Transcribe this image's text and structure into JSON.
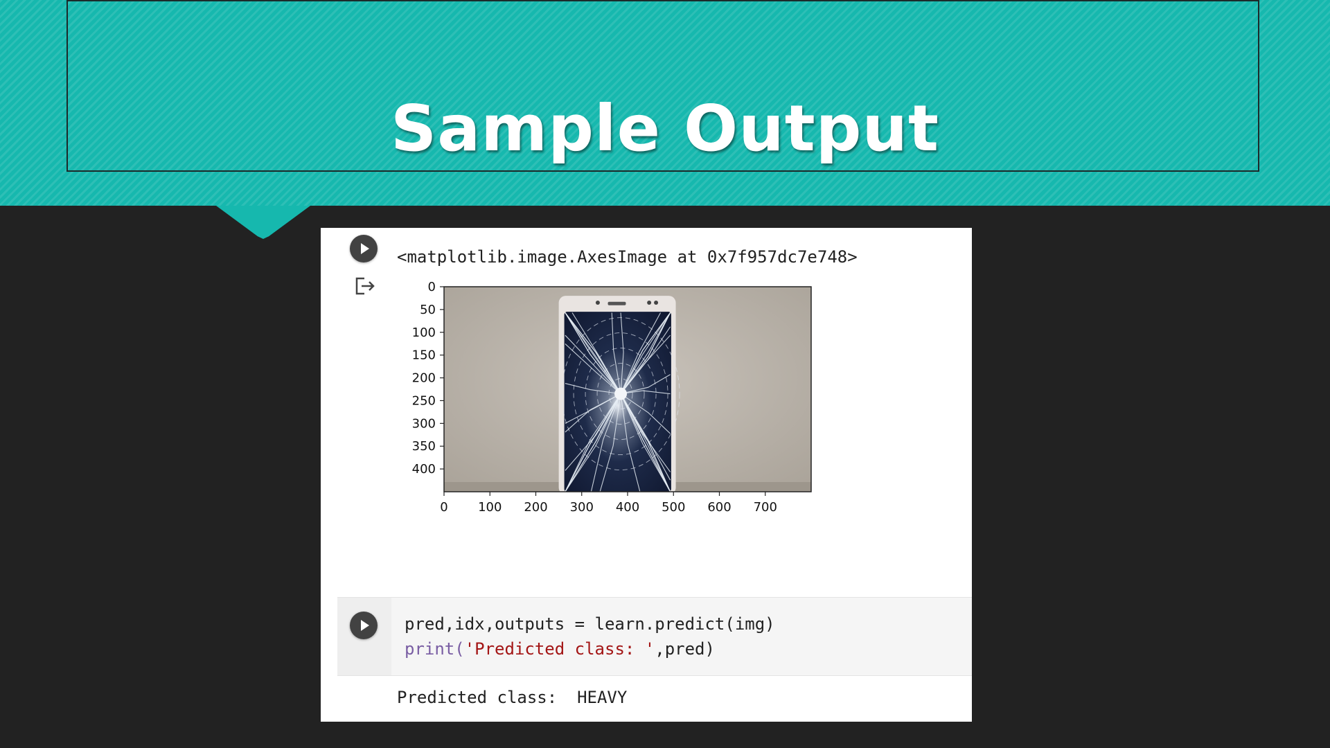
{
  "slide": {
    "title": "Sample Output",
    "colors": {
      "band": "#16b8ae",
      "background": "#222222"
    }
  },
  "notebook": {
    "output_repr": "<matplotlib.image.AxesImage at 0x7f957dc7e748>",
    "icons": {
      "run": "play-circle-icon",
      "output": "output-redirect-icon"
    },
    "code": {
      "line1": "pred,idx,outputs = learn.predict(img)",
      "line2_fn": "print(",
      "line2_str": "'Predicted class: '",
      "line2_rest": ",pred)"
    },
    "result": "Predicted class:  HEAVY"
  },
  "chart_data": {
    "type": "image",
    "title": "",
    "xlabel": "",
    "ylabel": "",
    "x_ticks": [
      "0",
      "100",
      "200",
      "300",
      "400",
      "500",
      "600",
      "700"
    ],
    "y_ticks": [
      "0",
      "50",
      "100",
      "150",
      "200",
      "250",
      "300",
      "350",
      "400"
    ],
    "xlim": [
      0,
      800
    ],
    "ylim": [
      450,
      0
    ],
    "grid": false,
    "image_content": "cracked-phone-photo"
  }
}
